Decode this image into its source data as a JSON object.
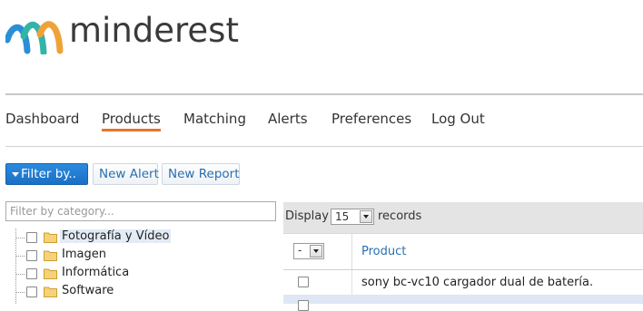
{
  "brand": {
    "name": "minderest",
    "colors": {
      "blue": "#2a8fd6",
      "teal": "#32b5a8",
      "orange": "#f0a23a"
    }
  },
  "nav": {
    "items": [
      {
        "label": "Dashboard",
        "active": false
      },
      {
        "label": "Products",
        "active": true
      },
      {
        "label": "Matching",
        "active": false
      },
      {
        "label": "Alerts",
        "active": false
      },
      {
        "label": "Preferences",
        "active": false
      },
      {
        "label": "Log Out",
        "active": false
      }
    ],
    "accent": "#e8742a"
  },
  "toolbar": {
    "filter_label": "Filter by..",
    "new_alert_label": "New Alert",
    "new_report_label": "New Report"
  },
  "category_filter": {
    "placeholder": "Filter by category...",
    "value": "",
    "items": [
      {
        "label": "Fotografía y Vídeo",
        "selected": true
      },
      {
        "label": "Imagen",
        "selected": false
      },
      {
        "label": "Informática",
        "selected": false
      },
      {
        "label": "Software",
        "selected": false
      }
    ]
  },
  "table": {
    "display_label": "Display",
    "page_size": "15",
    "records_label": "records",
    "bulk_select_value": "-",
    "columns": [
      "Product"
    ],
    "rows": [
      {
        "product": "sony bc-vc10 cargador dual de batería."
      }
    ]
  }
}
